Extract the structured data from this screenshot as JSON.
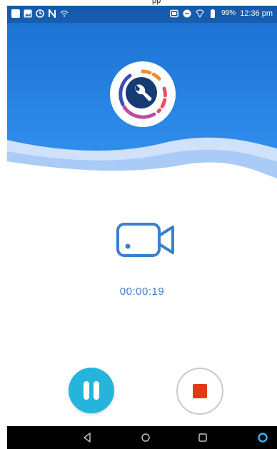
{
  "top_strip": {
    "label": "pp"
  },
  "status_bar": {
    "battery_percent": "99%",
    "time": "12:36 pm"
  },
  "recording": {
    "elapsed_time": "00:00:19"
  },
  "colors": {
    "header_blue": "#1f7ad8",
    "pause_cyan": "#25b5dc",
    "stop_red": "#e13a16",
    "camera_blue": "#3a7fd0"
  },
  "icons": {
    "app_logo": "wrench-icon",
    "camera": "video-camera-icon",
    "pause": "pause-icon",
    "stop": "stop-icon",
    "nav_back": "back-triangle-icon",
    "nav_home": "home-circle-icon",
    "nav_recents": "recents-square-icon",
    "assistant": "assistant-ring-icon"
  }
}
